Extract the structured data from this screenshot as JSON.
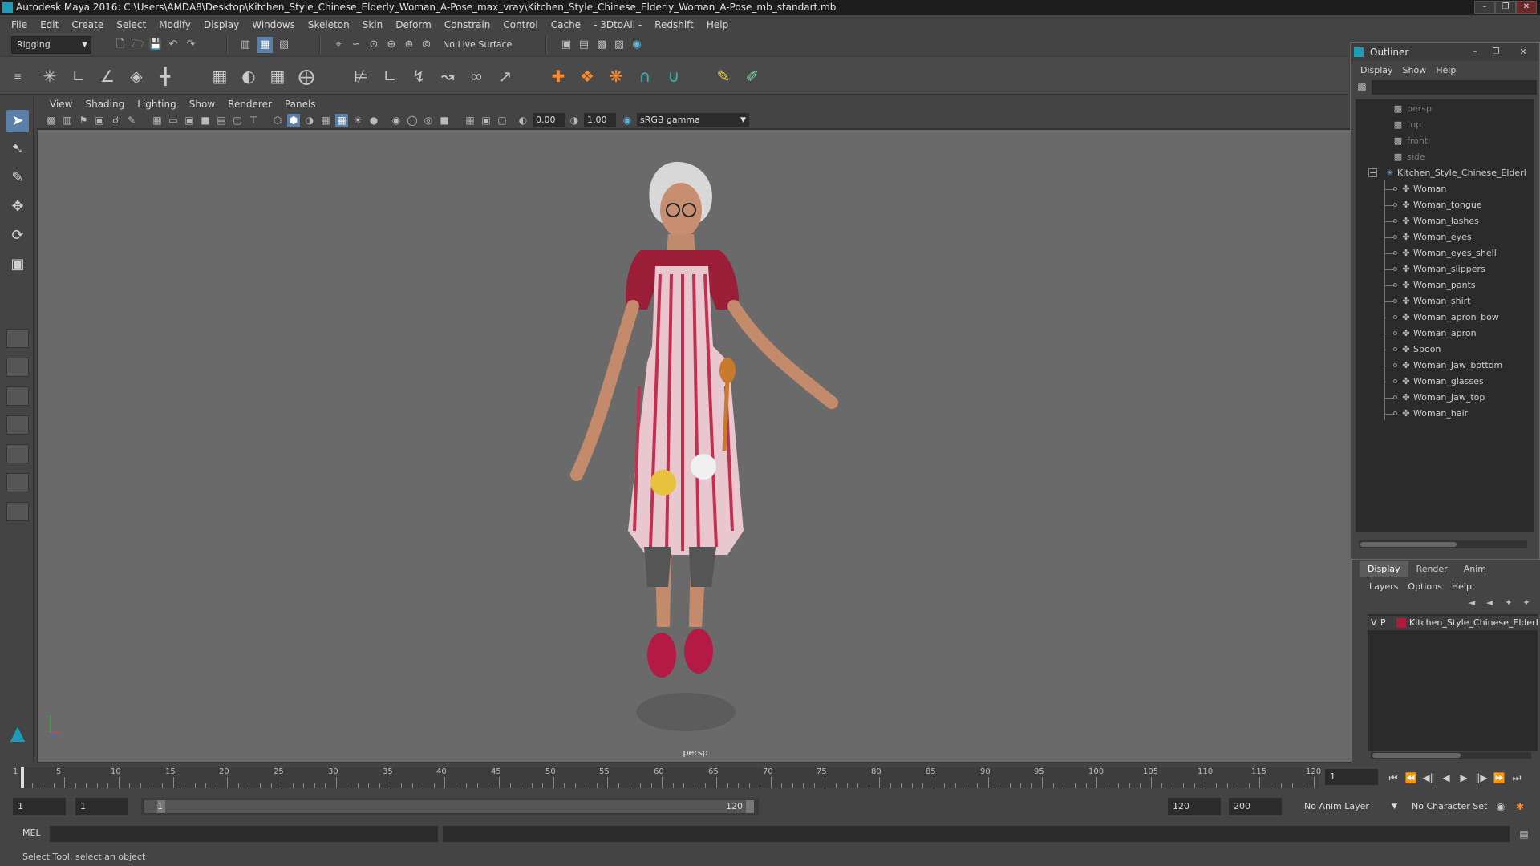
{
  "window": {
    "title": "Autodesk Maya 2016: C:\\Users\\AMDA8\\Desktop\\Kitchen_Style_Chinese_Elderly_Woman_A-Pose_max_vray\\Kitchen_Style_Chinese_Elderly_Woman_A-Pose_mb_standart.mb",
    "controls": [
      "minimize-icon",
      "restore-icon",
      "close-icon"
    ]
  },
  "menubar": [
    "File",
    "Edit",
    "Create",
    "Select",
    "Modify",
    "Display",
    "Windows",
    "Skeleton",
    "Skin",
    "Deform",
    "Constrain",
    "Control",
    "Cache",
    "- 3DtoAll -",
    "Redshift",
    "Help"
  ],
  "statusline": {
    "menuset": "Rigging",
    "live_surface": "No Live Surface"
  },
  "toolbox": {
    "tools": [
      "select-tool-icon",
      "lasso-tool-icon",
      "paint-select-icon",
      "move-tool-icon",
      "rotate-tool-icon",
      "scale-tool-icon"
    ]
  },
  "panel": {
    "menus": [
      "View",
      "Shading",
      "Lighting",
      "Show",
      "Renderer",
      "Panels"
    ],
    "exposure": "0.00",
    "gamma": "1.00",
    "colorspace": "sRGB gamma",
    "camera_label": "persp"
  },
  "outliner": {
    "title": "Outliner",
    "menus": [
      "Display",
      "Show",
      "Help"
    ],
    "cameras": [
      "persp",
      "top",
      "front",
      "side"
    ],
    "group": "Kitchen_Style_Chinese_Elderl",
    "children": [
      "Woman",
      "Woman_tongue",
      "Woman_lashes",
      "Woman_eyes",
      "Woman_eyes_shell",
      "Woman_slippers",
      "Woman_pants",
      "Woman_shirt",
      "Woman_apron_bow",
      "Woman_apron",
      "Spoon",
      "Woman_Jaw_bottom",
      "Woman_glasses",
      "Woman_Jaw_top",
      "Woman_hair"
    ]
  },
  "layers": {
    "tabs": [
      "Display",
      "Render",
      "Anim"
    ],
    "active_tab": "Display",
    "menus": [
      "Layers",
      "Options",
      "Help"
    ],
    "row": {
      "v": "V",
      "p": "P",
      "name": "Kitchen_Style_Chinese_Elderl",
      "color": "#b0193a"
    }
  },
  "timeslider": {
    "labels": [
      "1",
      "5",
      "10",
      "15",
      "20",
      "25",
      "30",
      "35",
      "40",
      "45",
      "50",
      "55",
      "60",
      "65",
      "70",
      "75",
      "80",
      "85",
      "90",
      "95",
      "100",
      "105",
      "110",
      "115",
      "120"
    ],
    "current_frame": "1"
  },
  "rangeslider": {
    "start": "1",
    "playback_start": "1",
    "range_start_label": "1",
    "range_end_label": "120",
    "playback_end": "120",
    "end": "200",
    "anim_layer": "No Anim Layer",
    "character_set": "No Character Set"
  },
  "cmdline": {
    "label": "MEL"
  },
  "helpline": {
    "text": "Select Tool: select an object"
  },
  "colors": {
    "accent": "#5a7fa8",
    "layer": "#b0193a",
    "maya_logo": "#1e9bb7"
  }
}
